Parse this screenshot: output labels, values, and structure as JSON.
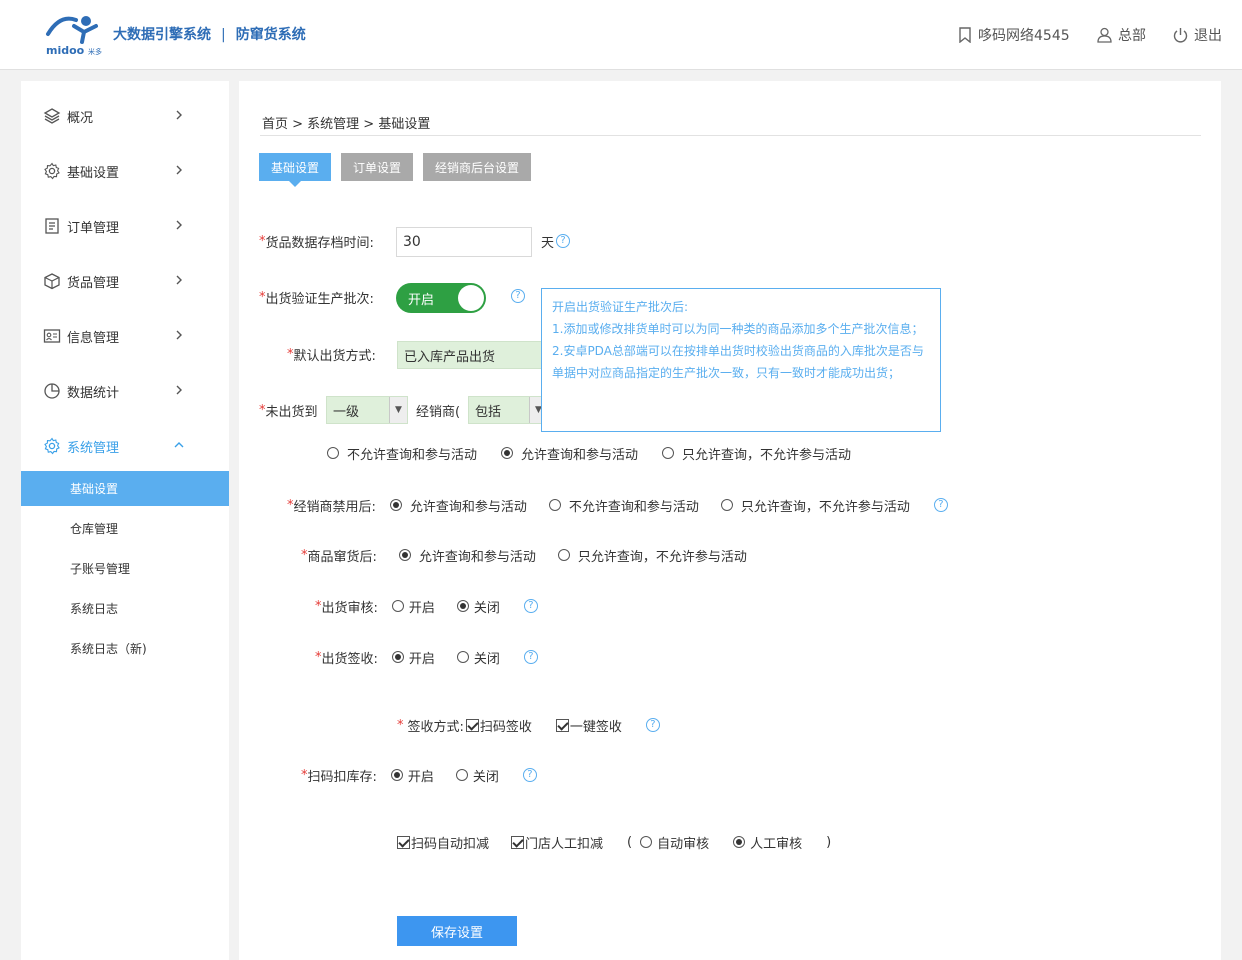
{
  "header": {
    "logo_text": "midoo 米多",
    "brand_primary": "大数据引擎系统",
    "brand_separator": "|",
    "brand_secondary": "防窜货系统",
    "account_name": "哆码网络4545",
    "role_label": "总部",
    "logout_label": "退出"
  },
  "sidebar": {
    "items": [
      {
        "label": "概况",
        "icon": "layers-icon"
      },
      {
        "label": "基础设置",
        "icon": "gear-icon"
      },
      {
        "label": "订单管理",
        "icon": "document-icon"
      },
      {
        "label": "货品管理",
        "icon": "box-icon"
      },
      {
        "label": "信息管理",
        "icon": "id-card-icon"
      },
      {
        "label": "数据统计",
        "icon": "pie-chart-icon"
      },
      {
        "label": "系统管理",
        "icon": "gear-icon"
      }
    ],
    "sub_items": [
      "基础设置",
      "仓库管理",
      "子账号管理",
      "系统日志",
      "系统日志（新)"
    ]
  },
  "main": {
    "breadcrumb": "首页 > 系统管理 > 基础设置",
    "tabs": [
      "基础设置",
      "订单设置",
      "经销商后台设置"
    ],
    "form": {
      "archive_label": "货品数据存档时间:",
      "archive_value": "30",
      "archive_unit": "天",
      "verify_batch_label": "出货验证生产批次:",
      "verify_batch_toggle": "开启",
      "default_ship_label": "默认出货方式:",
      "default_ship_value": "已入库产品出货",
      "unshipped_label": "未出货到",
      "unshipped_level": "一级",
      "dealer_prefix": "经销商(",
      "dealer_include": "包括",
      "unshipped_options": [
        "不允许查询和参与活动",
        "允许查询和参与活动",
        "只允许查询，不允许参与活动"
      ],
      "dealer_disabled_label": "经销商禁用后:",
      "dealer_disabled_options": [
        "允许查询和参与活动",
        "不允许查询和参与活动",
        "只允许查询，不允许参与活动"
      ],
      "product_diverted_label": "商品窜货后:",
      "product_diverted_options": [
        "允许查询和参与活动",
        "只允许查询，不允许参与活动"
      ],
      "ship_review_label": "出货审核:",
      "ship_sign_label": "出货签收:",
      "scan_deduct_label": "扫码扣库存:",
      "on_label": "开启",
      "off_label": "关闭",
      "sign_method_label": "签收方式:",
      "sign_methods": [
        "扫码签收",
        "一键签收"
      ],
      "deduct_options": [
        "扫码自动扣减",
        "门店人工扣减"
      ],
      "paren_open": "(",
      "paren_close": ")",
      "review_options": [
        "自动审核",
        "人工审核"
      ],
      "help_glyph": "?",
      "required_mark": "*"
    },
    "tooltip": {
      "title": "开启出货验证生产批次后:",
      "line1": "1.添加或修改排货单时可以为同一种类的商品添加多个生产批次信息；",
      "line2": "2.安卓PDA总部端可以在按排单出货时校验出货商品的入库批次是否与单据中对应商品指定的生产批次一致，只有一致时才能成功出货；"
    },
    "save_button": "保存设置"
  },
  "colors": {
    "brand": "#2e6db6",
    "accent": "#5aaeef",
    "toggle_on": "#2ea043",
    "save_button": "#3d96f0",
    "required": "#e53935"
  }
}
